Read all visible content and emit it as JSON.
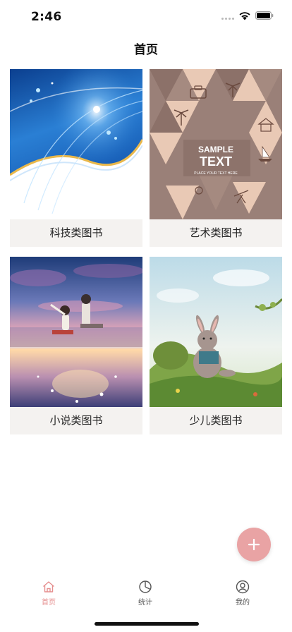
{
  "status_bar": {
    "time": "2:46"
  },
  "nav": {
    "title": "首页"
  },
  "categories": [
    {
      "label": "科技类图书",
      "cover_icon": "tech-cover-image"
    },
    {
      "label": "艺术类图书",
      "cover_icon": "art-cover-image",
      "cover_title": "SAMPLE",
      "cover_title2": "TEXT",
      "cover_sub": "PLACE YOUR TEXT HERE"
    },
    {
      "label": "小说类图书",
      "cover_icon": "novel-cover-image"
    },
    {
      "label": "少儿类图书",
      "cover_icon": "children-cover-image"
    }
  ],
  "fab": {
    "icon": "plus-icon",
    "color": "#e9a3a4"
  },
  "tabbar": {
    "items": [
      {
        "label": "首页",
        "icon": "home-icon",
        "active": true
      },
      {
        "label": "统计",
        "icon": "pie-chart-icon",
        "active": false
      },
      {
        "label": "我的",
        "icon": "user-icon",
        "active": false
      }
    ],
    "active_color": "#e58e8e"
  }
}
